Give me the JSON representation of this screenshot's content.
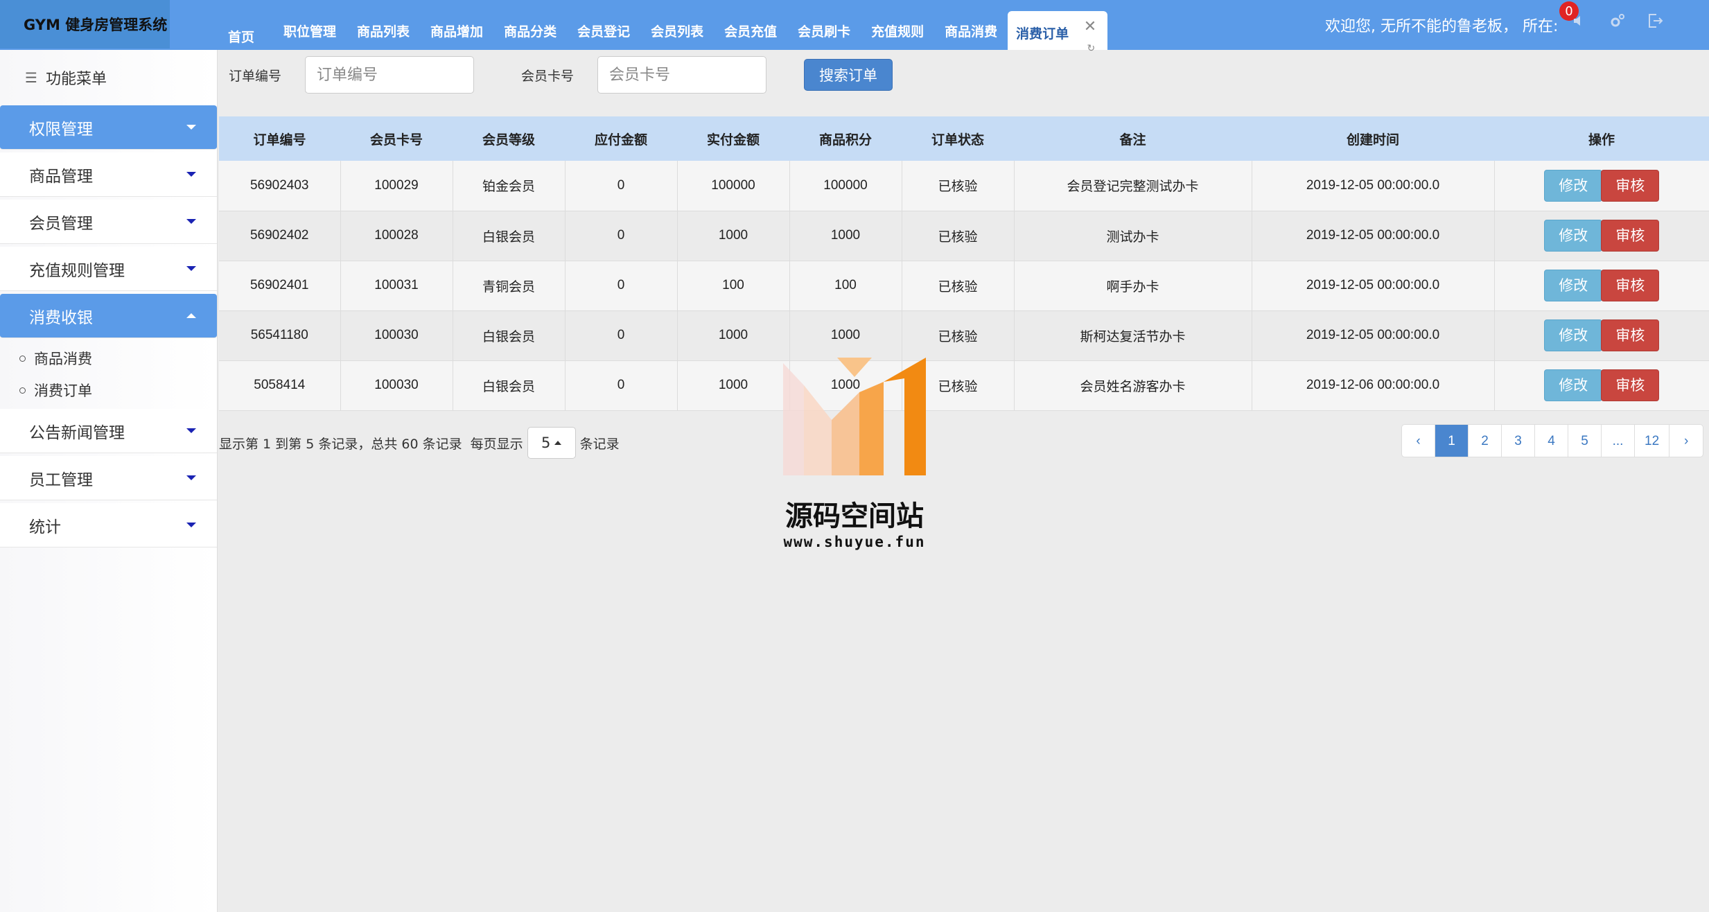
{
  "app": {
    "title": "GYM 健身房管理系统"
  },
  "nav": {
    "home": "首页",
    "tabs": [
      "职位管理",
      "商品列表",
      "商品增加",
      "商品分类",
      "会员登记",
      "会员列表",
      "会员充值",
      "会员刷卡",
      "充值规则",
      "商品消费"
    ],
    "active_tab": "消费订单"
  },
  "header": {
    "welcome": "欢迎您, 无所不能的鲁老板， 所在:",
    "notification_count": "0"
  },
  "sidebar": {
    "title": "功能菜单",
    "items": [
      {
        "label": "权限管理"
      },
      {
        "label": "商品管理"
      },
      {
        "label": "会员管理"
      },
      {
        "label": "充值规则管理"
      },
      {
        "label": "消费收银"
      },
      {
        "label": "公告新闻管理"
      },
      {
        "label": "员工管理"
      },
      {
        "label": "统计"
      }
    ],
    "sub_items": [
      "商品消费",
      "消费订单"
    ]
  },
  "search": {
    "order_label": "订单编号",
    "order_placeholder": "订单编号",
    "card_label": "会员卡号",
    "card_placeholder": "会员卡号",
    "button": "搜索订单"
  },
  "table": {
    "columns": [
      "订单编号",
      "会员卡号",
      "会员等级",
      "应付金额",
      "实付金额",
      "商品积分",
      "订单状态",
      "备注",
      "创建时间",
      "操作"
    ],
    "rows": [
      [
        "56902403",
        "100029",
        "铂金会员",
        "0",
        "100000",
        "100000",
        "已核验",
        "会员登记完整测试办卡",
        "2019-12-05 00:00:00.0"
      ],
      [
        "56902402",
        "100028",
        "白银会员",
        "0",
        "1000",
        "1000",
        "已核验",
        "测试办卡",
        "2019-12-05 00:00:00.0"
      ],
      [
        "56902401",
        "100031",
        "青铜会员",
        "0",
        "100",
        "100",
        "已核验",
        "啊手办卡",
        "2019-12-05 00:00:00.0"
      ],
      [
        "56541180",
        "100030",
        "白银会员",
        "0",
        "1000",
        "1000",
        "已核验",
        "斯柯达复活节办卡",
        "2019-12-05 00:00:00.0"
      ],
      [
        "5058414",
        "100030",
        "白银会员",
        "0",
        "1000",
        "1000",
        "已核验",
        "会员姓名游客办卡",
        "2019-12-06 00:00:00.0"
      ]
    ],
    "edit_label": "修改",
    "audit_label": "审核"
  },
  "pagination": {
    "summary": "显示第 1 到第 5 条记录，总共 60 条记录  每页显示",
    "page_size": "5",
    "suffix": "条记录",
    "pages": [
      "‹",
      "1",
      "2",
      "3",
      "4",
      "5",
      "...",
      "12",
      "›"
    ],
    "active_page": "1"
  },
  "watermark": {
    "title": "源码空间站",
    "url": "www.shuyue.fun"
  },
  "colors": {
    "topbar": "#5b9be8",
    "accent": "#4a86cf",
    "edit": "#6fb6d9",
    "audit": "#c9463f",
    "table_header": "#c6dcf5"
  }
}
